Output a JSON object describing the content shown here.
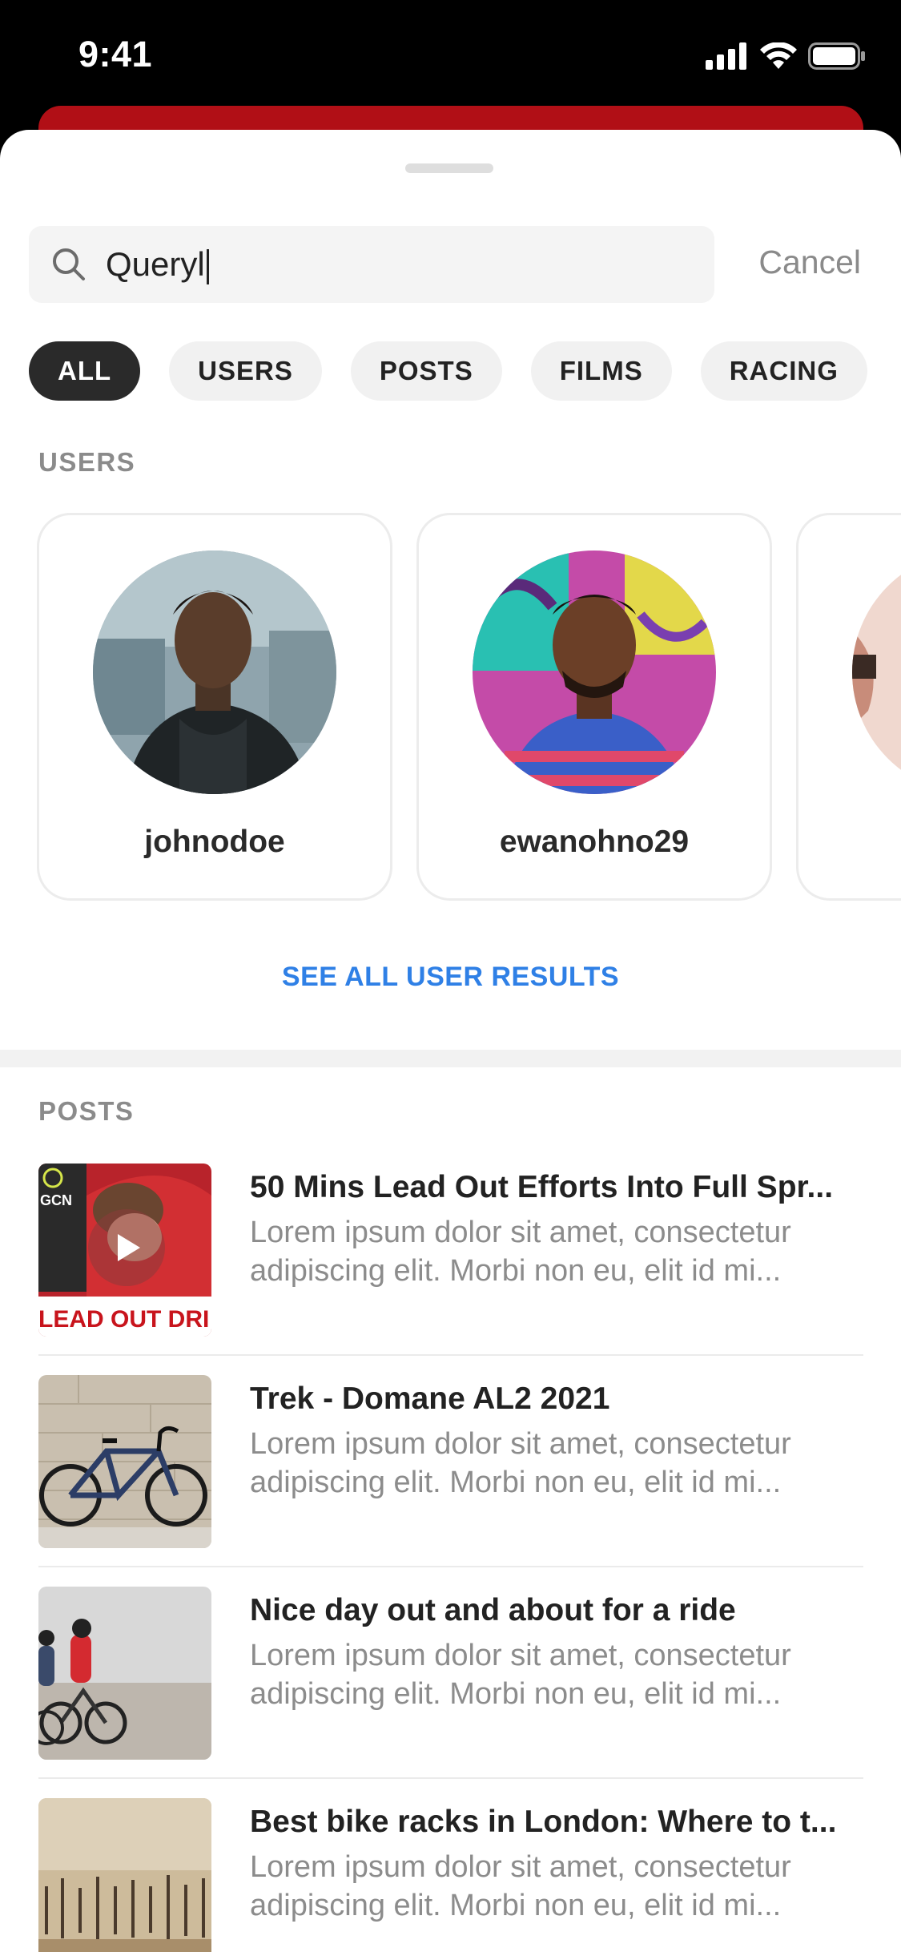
{
  "status_bar": {
    "time": "9:41"
  },
  "search": {
    "query": "Queryl",
    "cancel_label": "Cancel"
  },
  "filters": [
    "ALL",
    "USERS",
    "POSTS",
    "FILMS",
    "RACING"
  ],
  "users_section": {
    "label": "USERS",
    "users": [
      {
        "username": "johnodoe"
      },
      {
        "username": "ewanohno29"
      },
      {
        "username": ""
      }
    ],
    "see_all_label": "SEE ALL USER RESULTS"
  },
  "posts_section": {
    "label": "POSTS",
    "posts": [
      {
        "title": "50 Mins Lead Out Efforts Into Full Spr...",
        "description": "Lorem ipsum dolor sit amet, consectetur adipiscing elit. Morbi non eu, elit id mi...",
        "thumb_text": "LEAD OUT DRI",
        "thumb_logo": "GCN"
      },
      {
        "title": "Trek - Domane AL2 2021",
        "description": "Lorem ipsum dolor sit amet, consectetur adipiscing elit. Morbi non eu, elit id mi..."
      },
      {
        "title": "Nice day out and about for a ride",
        "description": "Lorem ipsum dolor sit amet, consectetur adipiscing elit. Morbi non eu, elit id mi..."
      },
      {
        "title": "Best bike racks in London: Where to t...",
        "description": "Lorem ipsum dolor sit amet, consectetur adipiscing elit. Morbi non eu, elit id mi..."
      }
    ]
  },
  "colors": {
    "brand_red": "#b10f16",
    "link_blue": "#2f80e6",
    "chip_active": "#2a2a2a"
  }
}
